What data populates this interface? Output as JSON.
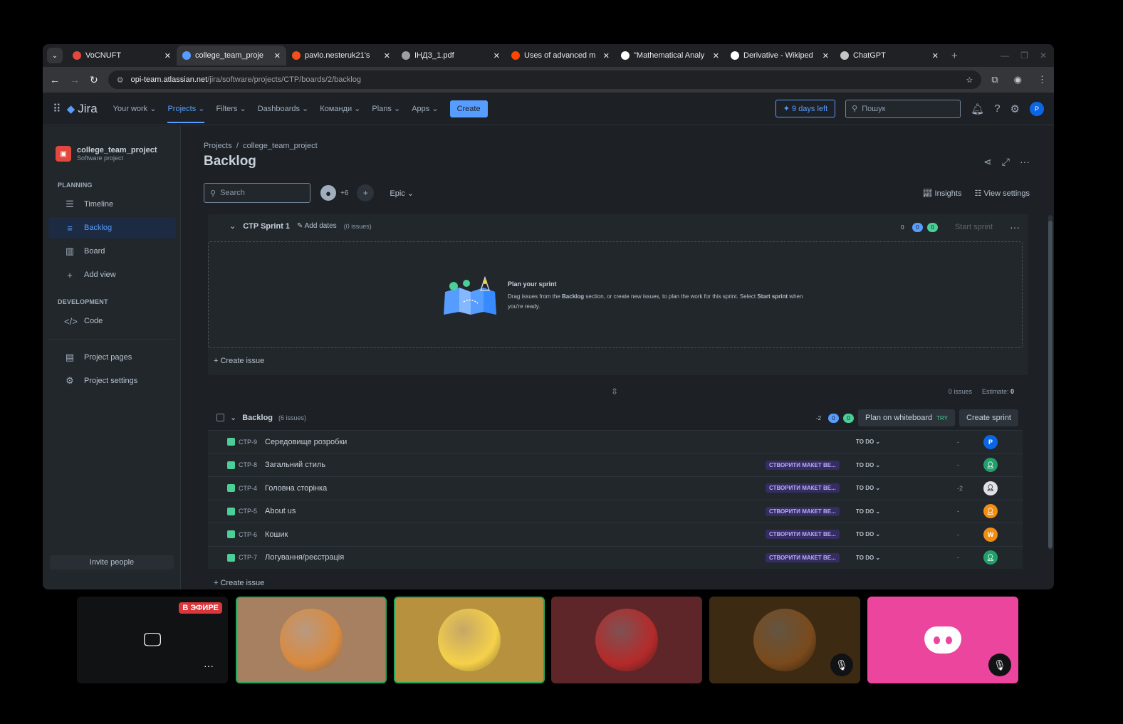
{
  "browser": {
    "tabs": [
      {
        "title": "VoCNUFT",
        "favicon_color": "#e2483d"
      },
      {
        "title": "college_team_proje",
        "favicon_color": "#579dff"
      },
      {
        "title": "pavlo.nesteruk21's",
        "favicon_color": "#f24e1e"
      },
      {
        "title": "ІНДЗ_1.pdf",
        "favicon_color": "#9aa0a6"
      },
      {
        "title": "Uses of advanced m",
        "favicon_color": "#ff4500"
      },
      {
        "title": "\"Mathematical Analy",
        "favicon_color": "#ffffff"
      },
      {
        "title": "Derivative - Wikiped",
        "favicon_color": "#ffffff"
      },
      {
        "title": "ChatGPT",
        "favicon_color": "#c4c7c5"
      }
    ],
    "active_tab_index": 1,
    "url_host": "opi-team.atlassian.net",
    "url_path": "/jira/software/projects/CTP/boards/2/backlog"
  },
  "jira_nav": {
    "logo": "Jira",
    "items": [
      "Your work ⌄",
      "Projects ⌄",
      "Filters ⌄",
      "Dashboards ⌄",
      "Команди ⌄",
      "Plans ⌄",
      "Apps ⌄"
    ],
    "active_item": "Projects ⌄",
    "create_label": "Create",
    "trial_label": "9 days left",
    "search_placeholder": "Пошук",
    "avatar_letter": "P"
  },
  "sidebar": {
    "project_name": "college_team_project",
    "project_type": "Software project",
    "planning_heading": "PLANNING",
    "planning_items": [
      {
        "label": "Timeline",
        "icon": "timeline-icon",
        "active": false
      },
      {
        "label": "Backlog",
        "icon": "backlog-icon",
        "active": true
      },
      {
        "label": "Board",
        "icon": "board-icon",
        "active": false
      },
      {
        "label": "Add view",
        "icon": "plus-icon",
        "active": false
      }
    ],
    "development_heading": "DEVELOPMENT",
    "code_label": "Code",
    "project_pages_label": "Project pages",
    "project_settings_label": "Project settings",
    "invite_label": "Invite people"
  },
  "main": {
    "breadcrumb_root": "Projects",
    "breadcrumb_sep": "/",
    "breadcrumb_project": "college_team_project",
    "title": "Backlog",
    "search_placeholder": "Search",
    "avatars_extra": "+6",
    "epic_filter": "Epic ⌄",
    "insights_label": "Insights",
    "view_settings_label": "View settings"
  },
  "sprint": {
    "name": "CTP Sprint 1",
    "add_dates": "Add dates",
    "issue_count": "(0 issues)",
    "counts": [
      "0",
      "0",
      "0"
    ],
    "start_label": "Start sprint",
    "empty_title": "Plan your sprint",
    "empty_text_1": "Drag issues from the ",
    "empty_text_bold_1": "Backlog",
    "empty_text_2": " section, or create new issues, to plan the work for this sprint. Select ",
    "empty_text_bold_2": "Start sprint",
    "empty_text_3": " when you're ready.",
    "create_issue": "Create issue",
    "footer_issues": "0 issues",
    "footer_estimate_label": "Estimate:",
    "footer_estimate_value": "0"
  },
  "backlog": {
    "name": "Backlog",
    "issue_count": "(6 issues)",
    "counts": [
      "-2",
      "0",
      "0"
    ],
    "plan_whiteboard": "Plan on whiteboard",
    "try_badge": "TRY",
    "create_sprint": "Create sprint",
    "create_issue": "Create issue",
    "issues": [
      {
        "key": "CTP-9",
        "summary": "Середовище розробки",
        "epic": "",
        "status": "TO DO ⌄",
        "estimate": "-",
        "assignee": "P",
        "assignee_color": "#0c66e4"
      },
      {
        "key": "CTP-8",
        "summary": "Загальний стиль",
        "epic": "СТВОРИТИ МАКЕТ ВЕ...",
        "status": "TO DO ⌄",
        "estimate": "-",
        "assignee": "",
        "assignee_color": "#22a06b"
      },
      {
        "key": "CTP-4",
        "summary": "Головна сторінка",
        "epic": "СТВОРИТИ МАКЕТ ВЕ...",
        "status": "TO DO ⌄",
        "estimate": "-2",
        "assignee": "",
        "assignee_color": "#dfe1e6"
      },
      {
        "key": "CTP-5",
        "summary": "About us",
        "epic": "СТВОРИТИ МАКЕТ ВЕ...",
        "status": "TO DO ⌄",
        "estimate": "-",
        "assignee": "",
        "assignee_color": "#f18d13"
      },
      {
        "key": "CTP-6",
        "summary": "Кошик",
        "epic": "СТВОРИТИ МАКЕТ ВЕ...",
        "status": "TO DO ⌄",
        "estimate": "-",
        "assignee": "W",
        "assignee_color": "#f18d13"
      },
      {
        "key": "CTP-7",
        "summary": "Логування/реєстрація",
        "epic": "СТВОРИТИ МАКЕТ ВЕ...",
        "status": "TO DO ⌄",
        "estimate": "-",
        "assignee": "",
        "assignee_color": "#22a06b"
      }
    ]
  },
  "call": {
    "live_badge": "В ЭФИРЕ",
    "tiles": [
      {
        "kind": "screen-share",
        "bg": "#111214",
        "speaking": false,
        "muted": false
      },
      {
        "kind": "avatar",
        "bg": "#a78062",
        "speaking": true,
        "muted": false,
        "avatar_color": "#d98a3e"
      },
      {
        "kind": "avatar",
        "bg": "#b8913f",
        "speaking": true,
        "muted": false,
        "avatar_color": "#f5d14a"
      },
      {
        "kind": "avatar",
        "bg": "#5e2628",
        "speaking": false,
        "muted": false,
        "avatar_color": "#b52a2a"
      },
      {
        "kind": "avatar",
        "bg": "#3c2a12",
        "speaking": false,
        "muted": true,
        "avatar_color": "#7a4a1c"
      },
      {
        "kind": "discord",
        "bg": "#eb459e",
        "speaking": false,
        "muted": true
      }
    ]
  }
}
